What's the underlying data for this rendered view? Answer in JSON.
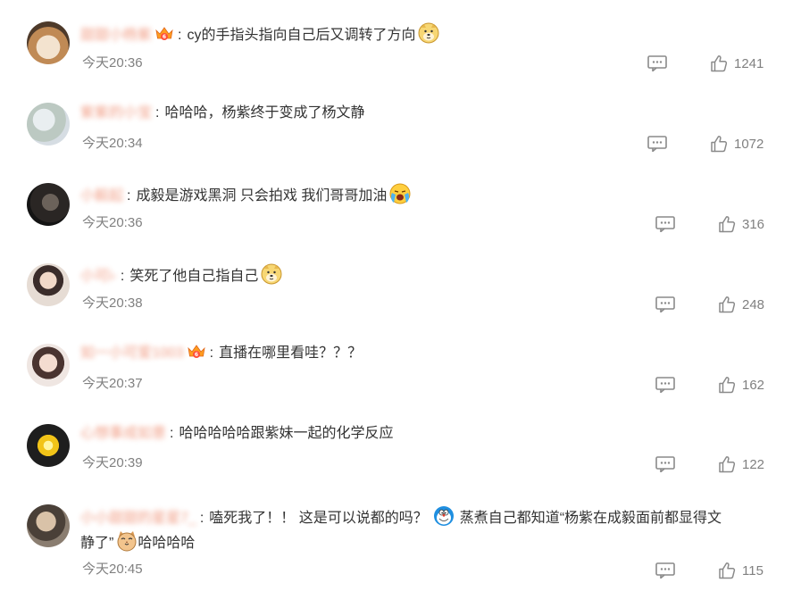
{
  "comments": [
    {
      "username": "甜甜小杨紫",
      "text": "cy的手指头指向自己后又调转了方向",
      "time": "今天20:36",
      "likes": "1241"
    },
    {
      "username": "紫紫的小宝",
      "text": "哈哈哈，杨紫终于变成了杨文静",
      "time": "今天20:34",
      "likes": "1072"
    },
    {
      "username": "小毅起",
      "text": "成毅是游戏黑洞 只会拍戏 我们哥哥加油",
      "time": "今天20:36",
      "likes": "316"
    },
    {
      "username": "小可i-",
      "text": "笑死了他自己指自己",
      "time": "今天20:38",
      "likes": "248"
    },
    {
      "username": "如一小可爱1003",
      "text": "直播在哪里看哇？？？",
      "time": "今天20:37",
      "likes": "162"
    },
    {
      "username": "心想事成如意",
      "text": "哈哈哈哈哈跟紫妹一起的化学反应",
      "time": "今天20:39",
      "likes": "122"
    },
    {
      "username": "小小甜甜的星星7_",
      "text_part1": "嗑死我了！！ 这是可以说都的吗？",
      "text_part2": "蒸煮自己都知道“杨紫在成毅面前都显得文",
      "text_part3": "静了”",
      "text_part4": "哈哈哈哈",
      "time": "今天20:45",
      "likes": "115"
    }
  ],
  "colors": {
    "username": "#eb7350",
    "meta": "#808080",
    "text": "#333333"
  },
  "icons": [
    "reply-icon",
    "thumbs-up-icon",
    "vip-crown-icon",
    "doge-emoji",
    "cry-emoji",
    "doraemon-emoji",
    "cat-emoji"
  ]
}
